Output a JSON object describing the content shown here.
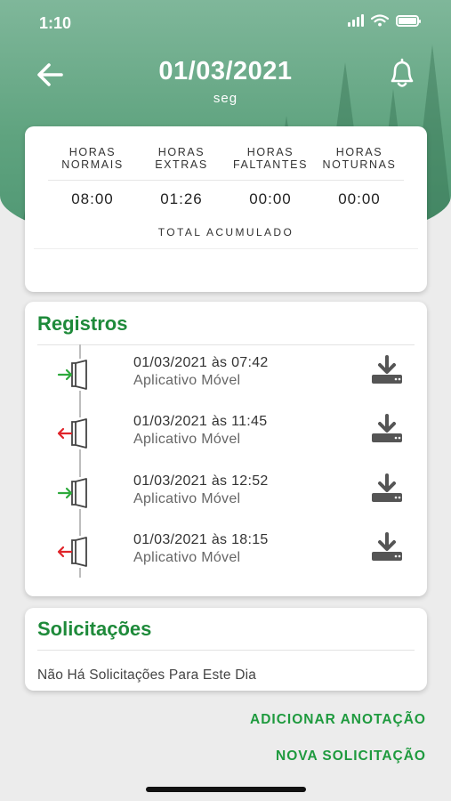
{
  "status_bar": {
    "time": "1:10"
  },
  "header": {
    "title": "01/03/2021",
    "subtitle": "seg"
  },
  "summary": {
    "columns": [
      {
        "label_line1": "HORAS",
        "label_line2": "NORMAIS",
        "value": "08:00"
      },
      {
        "label_line1": "HORAS",
        "label_line2": "EXTRAS",
        "value": "01:26"
      },
      {
        "label_line1": "HORAS",
        "label_line2": "FALTANTES",
        "value": "00:00"
      },
      {
        "label_line1": "HORAS",
        "label_line2": "NOTURNAS",
        "value": "00:00"
      }
    ],
    "total_label": "TOTAL ACUMULADO"
  },
  "registros": {
    "title": "Registros",
    "items": [
      {
        "datetime": "01/03/2021 às 07:42",
        "source": "Aplicativo Móvel",
        "direction": "entrada",
        "icon": "door-enter-icon",
        "arrow_color": "#2eaa3c"
      },
      {
        "datetime": "01/03/2021 às 11:45",
        "source": "Aplicativo Móvel",
        "direction": "saida",
        "icon": "door-exit-icon",
        "arrow_color": "#e0242a"
      },
      {
        "datetime": "01/03/2021 às 12:52",
        "source": "Aplicativo Móvel",
        "direction": "entrada",
        "icon": "door-enter-icon",
        "arrow_color": "#2eaa3c"
      },
      {
        "datetime": "01/03/2021 às 18:15",
        "source": "Aplicativo Móvel",
        "direction": "saida",
        "icon": "door-exit-icon",
        "arrow_color": "#e0242a"
      }
    ]
  },
  "solicitacoes": {
    "title": "Solicitações",
    "empty_message": "Não Há Solicitações Para Este Dia"
  },
  "actions": {
    "add_note": "ADICIONAR ANOTAÇÃO",
    "new_request": "NOVA SOLICITAÇÃO"
  },
  "colors": {
    "accent_green": "#1e8a3a",
    "link_green": "#1e9a3e",
    "header_green": "#5fa37f"
  }
}
